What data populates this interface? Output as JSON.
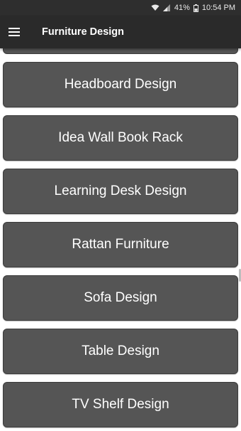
{
  "status_bar": {
    "battery_percent": "41%",
    "time": "10:54 PM",
    "icons": [
      "wifi-icon",
      "signal-icon",
      "battery-icon"
    ]
  },
  "app_bar": {
    "title": "Furniture Design",
    "menu_icon": "hamburger-menu-icon"
  },
  "list": {
    "items": [
      {
        "label": "Headboard Design"
      },
      {
        "label": "Idea Wall Book Rack"
      },
      {
        "label": "Learning Desk Design"
      },
      {
        "label": "Rattan Furniture"
      },
      {
        "label": "Sofa Design"
      },
      {
        "label": "Table Design"
      },
      {
        "label": "TV Shelf Design"
      }
    ]
  },
  "colors": {
    "item_background": "#555555",
    "app_bar_background": "#2a2a2a",
    "status_bar_background": "#2e2e2e",
    "page_background": "#ffffff"
  }
}
